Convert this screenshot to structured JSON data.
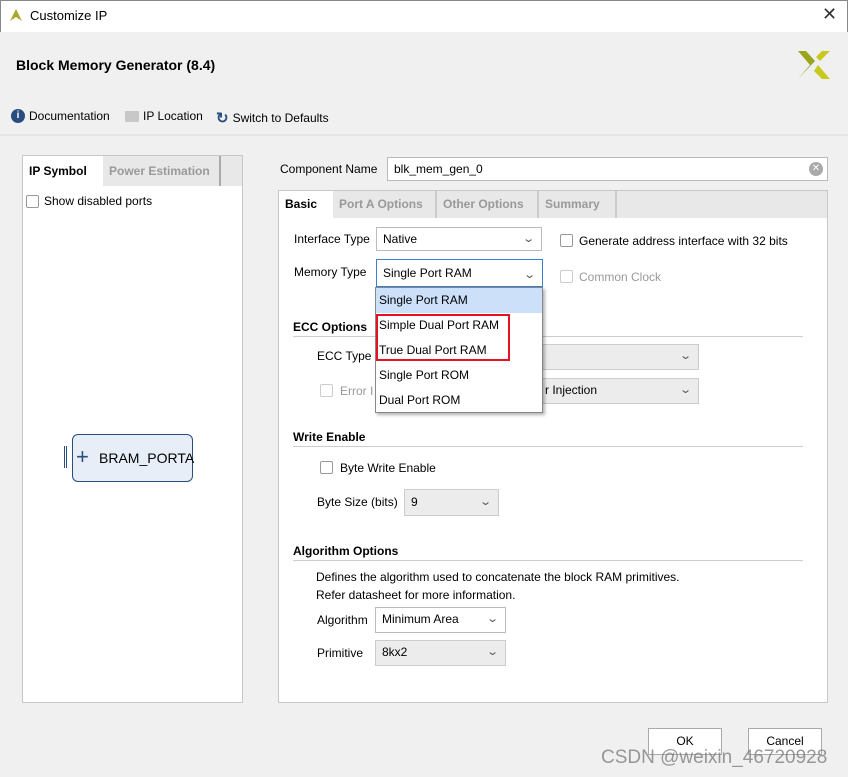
{
  "window": {
    "title": "Customize IP",
    "close": "✕"
  },
  "header": {
    "title": "Block Memory Generator (8.4)"
  },
  "toolbar": {
    "documentation": "Documentation",
    "ip_location": "IP Location",
    "switch_defaults": "Switch to Defaults"
  },
  "left": {
    "tabs": [
      "IP Symbol",
      "Power Estimation"
    ],
    "show_disabled": "Show disabled ports",
    "port": "BRAM_PORTA"
  },
  "component": {
    "label": "Component Name",
    "value": "blk_mem_gen_0"
  },
  "tabs": [
    "Basic",
    "Port A Options",
    "Other Options",
    "Summary"
  ],
  "basic": {
    "interface_type_label": "Interface Type",
    "interface_type": "Native",
    "gen_addr": "Generate address interface with 32 bits",
    "memory_type_label": "Memory Type",
    "memory_type": "Single Port RAM",
    "common_clock": "Common Clock",
    "memory_type_options": [
      "Single Port RAM",
      "Simple Dual Port RAM",
      "True Dual Port RAM",
      "Single Port ROM",
      "Dual Port ROM"
    ],
    "ecc_section": "ECC Options",
    "ecc_type_label": "ECC Type",
    "error_label_fragment": "Error I",
    "error_select_fragment": "r Injection",
    "write_section": "Write Enable",
    "byte_write": "Byte Write Enable",
    "byte_size_label": "Byte Size (bits)",
    "byte_size": "9",
    "algo_section": "Algorithm Options",
    "algo_desc1": "Defines the algorithm used to concatenate the block RAM primitives.",
    "algo_desc2": "Refer datasheet for more information.",
    "algorithm_label": "Algorithm",
    "algorithm": "Minimum Area",
    "primitive_label": "Primitive",
    "primitive": "8kx2"
  },
  "buttons": {
    "ok": "OK",
    "cancel": "Cancel"
  },
  "watermark": "CSDN @weixin_46720928",
  "colors": {
    "highlight": "#e81123",
    "selected": "#cce0fa",
    "accent": "#2a5fa8"
  }
}
